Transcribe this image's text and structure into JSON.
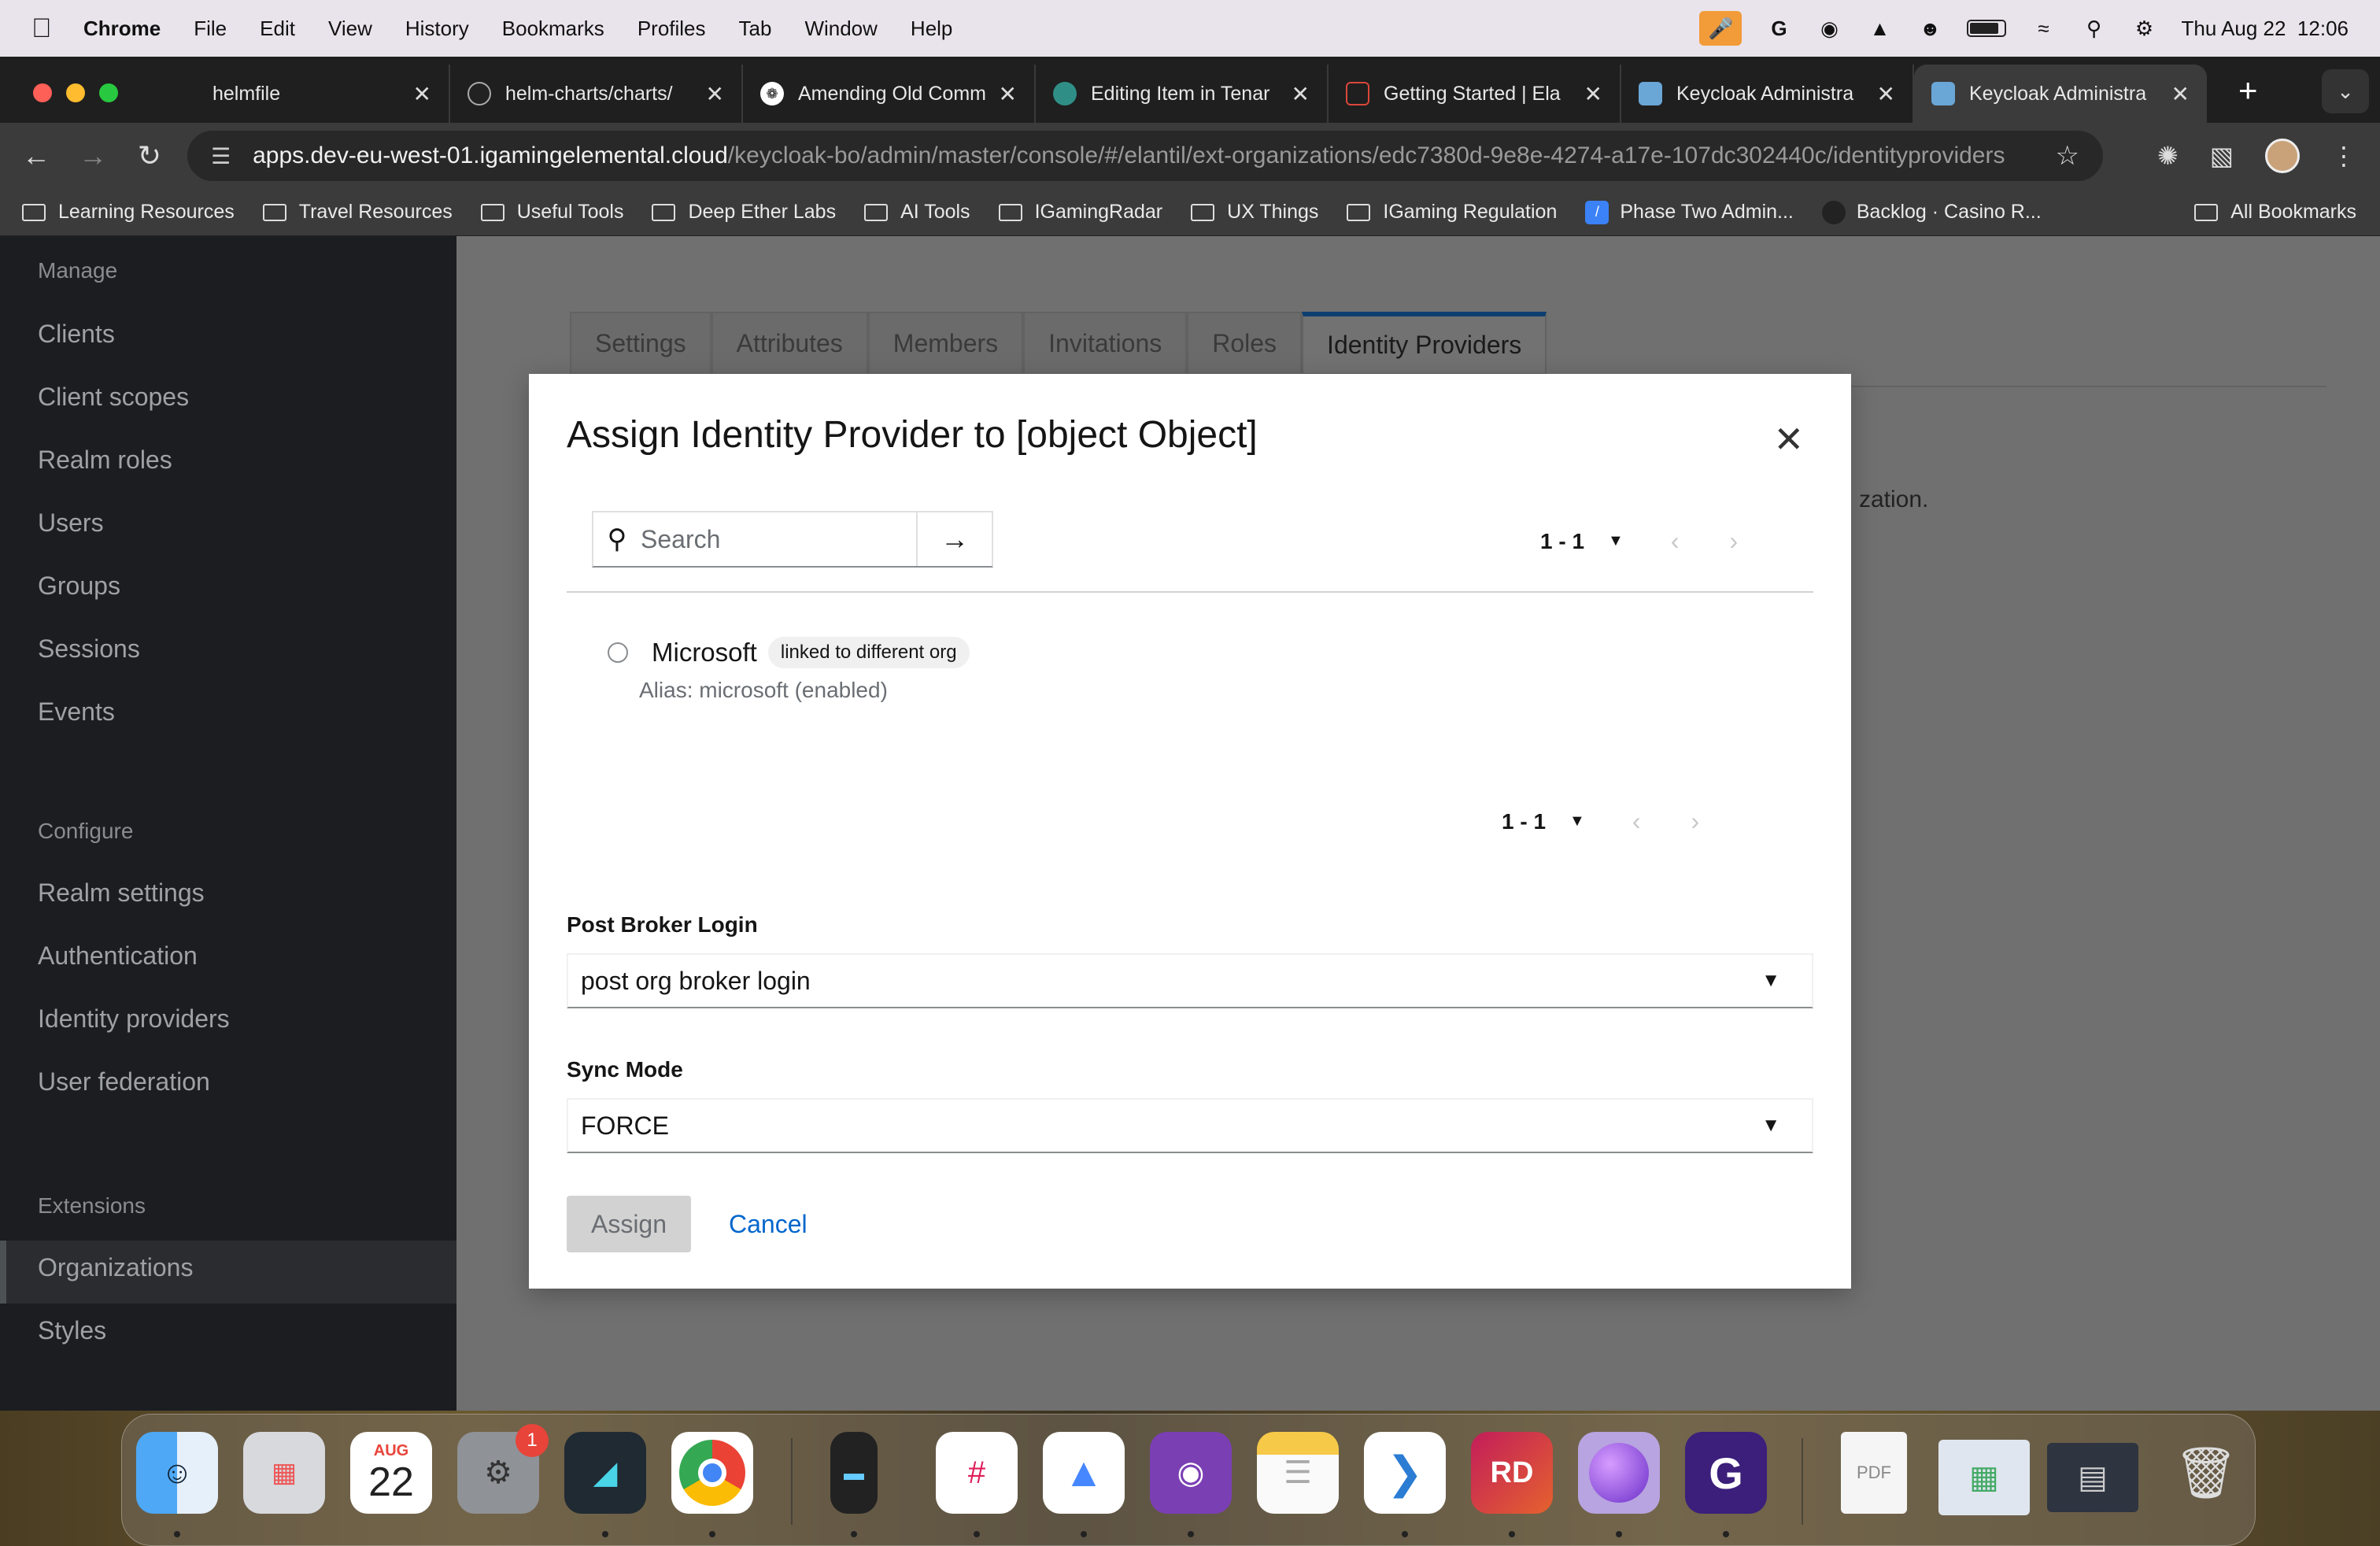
{
  "menubar": {
    "app_name": "Chrome",
    "items": [
      "File",
      "Edit",
      "View",
      "History",
      "Bookmarks",
      "Profiles",
      "Tab",
      "Window",
      "Help"
    ],
    "clock": "Thu Aug 22  12:06",
    "status_icons": [
      "microphone-icon",
      "grammarly-icon",
      "record-icon",
      "nordvpn-icon",
      "user-icon",
      "battery-icon",
      "wifi-icon",
      "search-icon",
      "control-center-icon"
    ]
  },
  "tabs": [
    {
      "title": "helmfile",
      "icon": "helmfile-icon",
      "color": "#1f1f1f"
    },
    {
      "title": "helm-charts/charts/",
      "icon": "github-icon",
      "color": "#222222"
    },
    {
      "title": "Amending Old Comm",
      "icon": "chatgpt-icon",
      "color": "#ffffff"
    },
    {
      "title": "Editing Item in Tenar",
      "icon": "circle-icon",
      "color": "#2f8f86"
    },
    {
      "title": "Getting Started | Ela",
      "icon": "elastic-icon",
      "color": "#d9473a"
    },
    {
      "title": "Keycloak Administra",
      "icon": "keycloak-icon",
      "color": "#6aa6d6"
    },
    {
      "title": "Keycloak Administra",
      "icon": "keycloak-icon",
      "color": "#6aa6d6"
    }
  ],
  "address_bar": {
    "host": "apps.dev-eu-west-01.igamingelemental.cloud",
    "path": "/keycloak-bo/admin/master/console/#/elantil/ext-organizations/edc7380d-9e8e-4274-a17e-107dc302440c/identityproviders"
  },
  "bookmarks": [
    {
      "label": "Learning Resources",
      "type": "folder"
    },
    {
      "label": "Travel Resources",
      "type": "folder"
    },
    {
      "label": "Useful Tools",
      "type": "folder"
    },
    {
      "label": "Deep Ether Labs",
      "type": "folder"
    },
    {
      "label": "AI Tools",
      "type": "folder"
    },
    {
      "label": "IGamingRadar",
      "type": "folder"
    },
    {
      "label": "UX Things",
      "type": "folder"
    },
    {
      "label": "IGaming Regulation",
      "type": "folder"
    },
    {
      "label": "Phase Two Admin...",
      "type": "link"
    },
    {
      "label": "Backlog · Casino R...",
      "type": "link"
    }
  ],
  "bookmarks_all": "All Bookmarks",
  "sidebar": {
    "manage_label": "Manage",
    "manage_items": [
      "Clients",
      "Client scopes",
      "Realm roles",
      "Users",
      "Groups",
      "Sessions",
      "Events"
    ],
    "configure_label": "Configure",
    "configure_items": [
      "Realm settings",
      "Authentication",
      "Identity providers",
      "User federation"
    ],
    "extensions_label": "Extensions",
    "extensions_items": [
      "Organizations",
      "Styles"
    ],
    "active_item": "Organizations"
  },
  "page": {
    "tabs": [
      "Settings",
      "Attributes",
      "Members",
      "Invitations",
      "Roles",
      "Identity Providers"
    ],
    "active_tab": "Identity Providers",
    "partial_text": "zation."
  },
  "modal": {
    "title": "Assign Identity Provider to [object Object]",
    "search_placeholder": "Search",
    "pagination_top": "1 - 1",
    "pagination_bottom": "1 - 1",
    "provider": {
      "name": "Microsoft",
      "badge": "linked to different org",
      "alias": "Alias: microsoft (enabled)"
    },
    "post_broker_label": "Post Broker Login",
    "post_broker_value": "post org broker login",
    "sync_mode_label": "Sync Mode",
    "sync_mode_value": "FORCE",
    "assign_label": "Assign",
    "cancel_label": "Cancel"
  },
  "dock": {
    "calendar_month": "AUG",
    "calendar_day": "22",
    "settings_badge": "1",
    "apps": [
      "finder-icon",
      "launchpad-icon",
      "calendar-icon",
      "system-settings-icon",
      "screen-sharing-icon",
      "chrome-icon",
      "activity-monitor-icon",
      "slack-icon",
      "nordvpn-icon",
      "github-desktop-icon",
      "notes-icon",
      "vscode-icon",
      "rider-icon",
      "siri-icon",
      "grammarly-icon",
      "pdf-document-icon",
      "map-screenshot-icon",
      "window-screenshot-icon",
      "trash-icon"
    ]
  }
}
